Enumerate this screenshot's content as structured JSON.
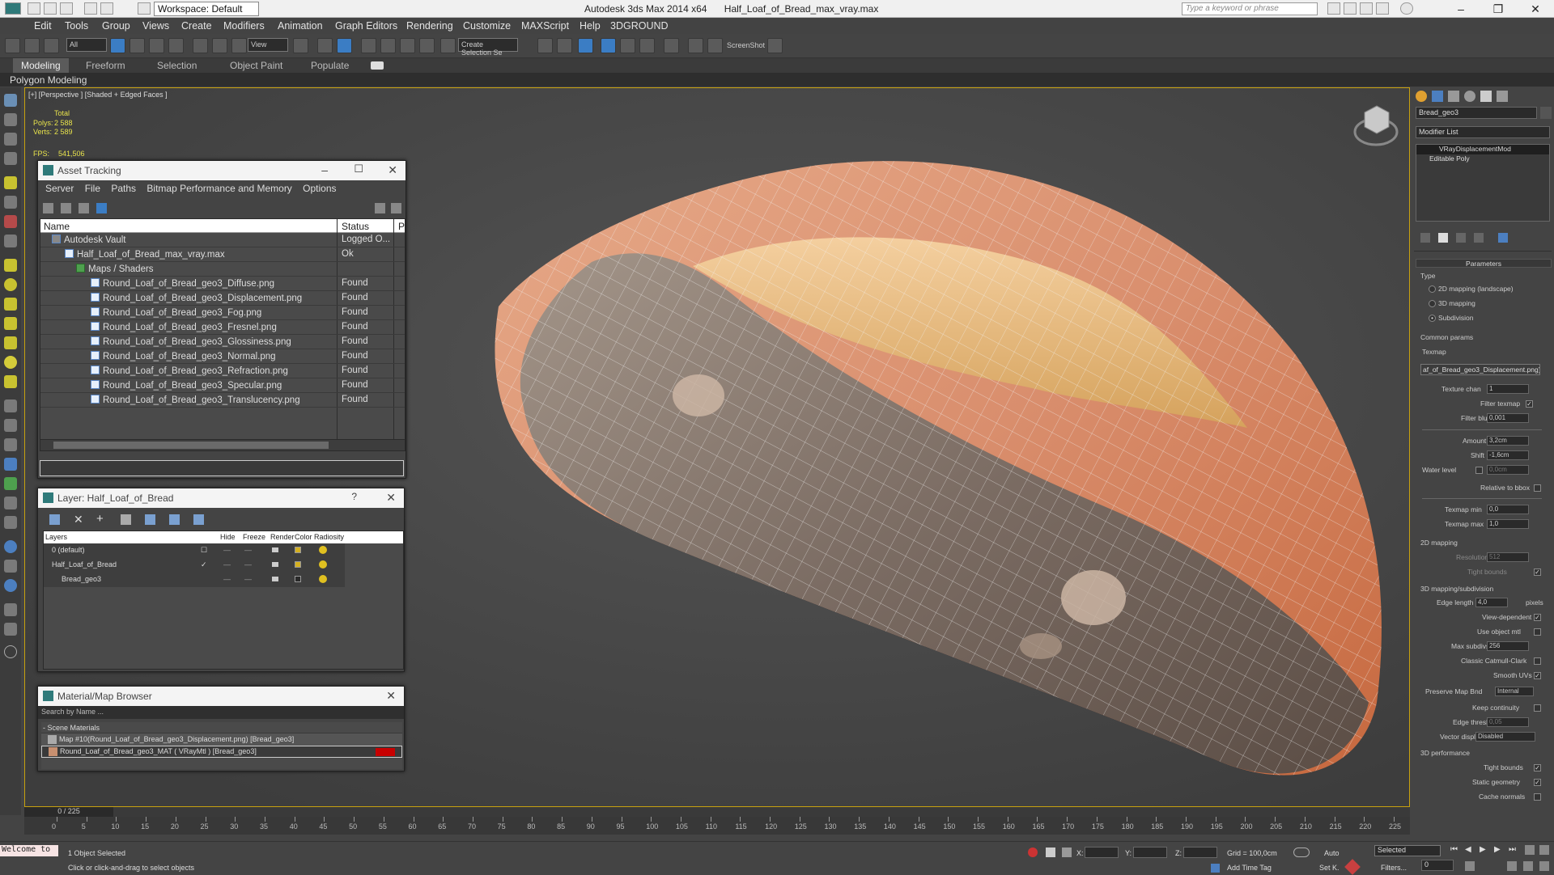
{
  "titlebar": {
    "workspace": "Workspace: Default",
    "app": "Autodesk 3ds Max  2014 x64",
    "file": "Half_Loaf_of_Bread_max_vray.max",
    "search_placeholder": "Type a keyword or phrase"
  },
  "menu": [
    "Edit",
    "Tools",
    "Group",
    "Views",
    "Create",
    "Modifiers",
    "Animation",
    "Graph Editors",
    "Rendering",
    "Customize",
    "MAXScript",
    "Help",
    "3DGROUND"
  ],
  "toolbar": {
    "filter": "All",
    "refcoord": "View",
    "selection_set": "Create Selection Se",
    "screenshot": "ScreenShot"
  },
  "ribbon": {
    "tabs": [
      "Modeling",
      "Freeform",
      "Selection",
      "Object Paint",
      "Populate"
    ],
    "sub": "Polygon Modeling"
  },
  "viewport": {
    "label": "[+] [Perspective ] [Shaded + Edged Faces ]",
    "total": "Total",
    "polys_label": "Polys:",
    "polys": "2 588",
    "verts_label": "Verts:",
    "verts": "2 589",
    "fps_label": "FPS:",
    "fps": "541,506"
  },
  "asset_tracking": {
    "title": "Asset Tracking",
    "menu": [
      "Server",
      "File",
      "Paths",
      "Bitmap Performance and Memory",
      "Options"
    ],
    "col_name": "Name",
    "col_status": "Status",
    "col_p": "P",
    "rows": [
      {
        "name": "Autodesk Vault",
        "status": "Logged O..."
      },
      {
        "name": "Half_Loaf_of_Bread_max_vray.max",
        "status": "Ok"
      },
      {
        "name": "Maps / Shaders",
        "status": ""
      },
      {
        "name": "Round_Loaf_of_Bread_geo3_Diffuse.png",
        "status": "Found"
      },
      {
        "name": "Round_Loaf_of_Bread_geo3_Displacement.png",
        "status": "Found"
      },
      {
        "name": "Round_Loaf_of_Bread_geo3_Fog.png",
        "status": "Found"
      },
      {
        "name": "Round_Loaf_of_Bread_geo3_Fresnel.png",
        "status": "Found"
      },
      {
        "name": "Round_Loaf_of_Bread_geo3_Glossiness.png",
        "status": "Found"
      },
      {
        "name": "Round_Loaf_of_Bread_geo3_Normal.png",
        "status": "Found"
      },
      {
        "name": "Round_Loaf_of_Bread_geo3_Refraction.png",
        "status": "Found"
      },
      {
        "name": "Round_Loaf_of_Bread_geo3_Specular.png",
        "status": "Found"
      },
      {
        "name": "Round_Loaf_of_Bread_geo3_Translucency.png",
        "status": "Found"
      }
    ]
  },
  "layer": {
    "title": "Layer: Half_Loaf_of_Bread",
    "headers": [
      "Layers",
      "Hide",
      "Freeze",
      "Render",
      "Color",
      "Radiosity"
    ],
    "rows": [
      {
        "name": "0 (default)",
        "mark": "☐"
      },
      {
        "name": "Half_Loaf_of_Bread",
        "mark": "✓"
      },
      {
        "name": "Bread_geo3",
        "mark": ""
      }
    ]
  },
  "material_browser": {
    "title": "Material/Map Browser",
    "search_placeholder": "Search by Name ...",
    "section": "- Scene Materials",
    "items": [
      "Map #10(Round_Loaf_of_Bread_geo3_Displacement.png) [Bread_geo3]",
      "Round_Loaf_of_Bread_geo3_MAT ( VRayMtl ) [Bread_geo3]"
    ]
  },
  "command_panel": {
    "object_name": "Bread_geo3",
    "modifier_list": "Modifier List",
    "stack": [
      "VRayDisplacementMod",
      "Editable Poly"
    ],
    "parameters": "Parameters",
    "type_label": "Type",
    "types": [
      "2D mapping (landscape)",
      "3D mapping",
      "Subdivision"
    ],
    "common": "Common params",
    "texmap_label": "Texmap",
    "texmap": "af_of_Bread_geo3_Displacement.png)",
    "texture_chan_label": "Texture chan",
    "texture_chan": "1",
    "filter_texmap": "Filter texmap",
    "filter_blur_label": "Filter blur",
    "filter_blur": "0,001",
    "amount_label": "Amount",
    "amount": "3,2cm",
    "shift_label": "Shift",
    "shift": "-1,6cm",
    "water_label": "Water level",
    "water": "0,0cm",
    "relative": "Relative to bbox",
    "texmap_min_label": "Texmap min",
    "texmap_min": "0,0",
    "texmap_max_label": "Texmap max",
    "texmap_max": "1,0",
    "mapping2d": "2D mapping",
    "resolution_label": "Resolution",
    "resolution": "512",
    "tight_bounds": "Tight bounds",
    "mapping3d": "3D mapping/subdivision",
    "edge_length_label": "Edge length",
    "edge_length": "4,0",
    "pixels": "pixels",
    "view_dependent": "View-dependent",
    "use_object_mtl": "Use object mtl",
    "max_subdivs_label": "Max subdivs",
    "max_subdivs": "256",
    "catmull": "Classic Catmull-Clark",
    "smooth_uvs": "Smooth UVs",
    "preserve_label": "Preserve Map Bnd",
    "preserve": "Internal",
    "keep_continuity": "Keep continuity",
    "edge_thresh_label": "Edge thresh",
    "edge_thresh": "0,05",
    "vector_label": "Vector displ",
    "vector": "Disabled",
    "perf": "3D performance",
    "tight_bounds2": "Tight bounds",
    "static_geometry": "Static geometry",
    "cache_normals": "Cache normals"
  },
  "timeline": {
    "frame": "0 / 225",
    "ticks": [
      "0",
      "5",
      "10",
      "15",
      "20",
      "25",
      "30",
      "35",
      "40",
      "45",
      "50",
      "55",
      "60",
      "65",
      "70",
      "75",
      "80",
      "85",
      "90",
      "95",
      "100",
      "105",
      "110",
      "115",
      "120",
      "125",
      "130",
      "135",
      "140",
      "145",
      "150",
      "155",
      "160",
      "165",
      "170",
      "175",
      "180",
      "185",
      "190",
      "195",
      "200",
      "205",
      "210",
      "215",
      "220",
      "225"
    ]
  },
  "status": {
    "maxscript": "Welcome to",
    "selected": "1 Object Selected",
    "prompt": "Click or click-and-drag to select objects",
    "x_label": "X:",
    "y_label": "Y:",
    "z_label": "Z:",
    "grid": "Grid = 100,0cm",
    "add_time_tag": "Add Time Tag",
    "auto": "Auto",
    "set_key": "Set K.",
    "sel_mode": "Selected",
    "filters": "Filters...",
    "frame_field": "0"
  },
  "colors": {
    "accent": "#3b7dc4",
    "viewport_border": "#c7a10f",
    "stat": "#e7e24c"
  }
}
